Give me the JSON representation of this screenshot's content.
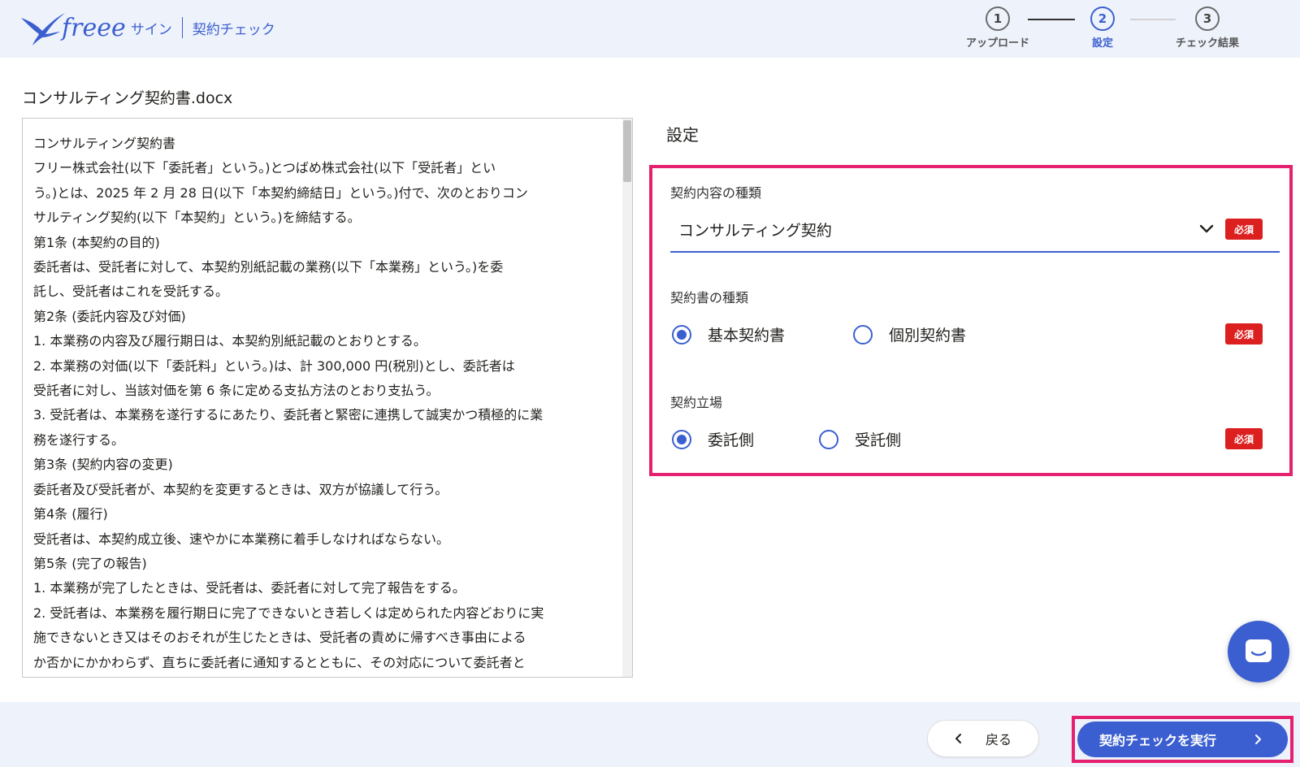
{
  "header": {
    "brand_sign": "サイン",
    "brand_sub": "契約チェック",
    "steps": [
      {
        "num": "1",
        "label": "アップロード"
      },
      {
        "num": "2",
        "label": "設定"
      },
      {
        "num": "3",
        "label": "チェック結果"
      }
    ],
    "active_step": 2
  },
  "document": {
    "filename": "コンサルティング契約書.docx",
    "lines": [
      "コンサルティング契約書",
      "フリー株式会社(以下「委託者」という。)とつばめ株式会社(以下「受託者」とい",
      "う。)とは、2025 年 2 月 28 日(以下「本契約締結日」という。)付で、次のとおりコン",
      "サルティング契約(以下「本契約」という。)を締結する。",
      "第1条 (本契約の目的)",
      "委託者は、受託者に対して、本契約別紙記載の業務(以下「本業務」という。)を委",
      "託し、受託者はこれを受託する。",
      "第2条 (委託内容及び対価)",
      "1. 本業務の内容及び履行期日は、本契約別紙記載のとおりとする。",
      "2. 本業務の対価(以下「委託料」という。)は、計 300,000 円(税別)とし、委託者は",
      "受託者に対し、当該対価を第 6 条に定める支払方法のとおり支払う。",
      "3. 受託者は、本業務を遂行するにあたり、委託者と緊密に連携して誠実かつ積極的に業",
      "務を遂行する。",
      "第3条 (契約内容の変更)",
      "委託者及び受託者が、本契約を変更するときは、双方が協議して行う。",
      "第4条 (履行)",
      "受託者は、本契約成立後、速やかに本業務に着手しなければならない。",
      "第5条 (完了の報告)",
      "1. 本業務が完了したときは、受託者は、委託者に対して完了報告をする。",
      "2. 受託者は、本業務を履行期日に完了できないとき若しくは定められた内容どおりに実",
      "施できないとき又はそのおそれが生じたときは、受託者の責めに帰すべき事由による",
      "か否かにかかわらず、直ちに委託者に通知するとともに、その対応について委託者と"
    ]
  },
  "settings": {
    "title": "設定",
    "required_badge": "必須",
    "contract_content": {
      "label": "契約内容の種類",
      "value": "コンサルティング契約"
    },
    "contract_doc_type": {
      "label": "契約書の種類",
      "options": [
        "基本契約書",
        "個別契約書"
      ],
      "selected": "基本契約書"
    },
    "position": {
      "label": "契約立場",
      "options": [
        "委託側",
        "受託側"
      ],
      "selected": "委託側"
    }
  },
  "footer": {
    "back_label": "戻る",
    "run_label": "契約チェックを実行"
  },
  "colors": {
    "accent": "#3b5fd0",
    "highlight": "#e5206f",
    "required": "#dc1f1f",
    "header_bg": "#eef2fb"
  },
  "icons": [
    "freee-bird-logo",
    "chevron-down-icon",
    "chevron-left-icon",
    "chevron-right-icon",
    "chat-icon"
  ]
}
